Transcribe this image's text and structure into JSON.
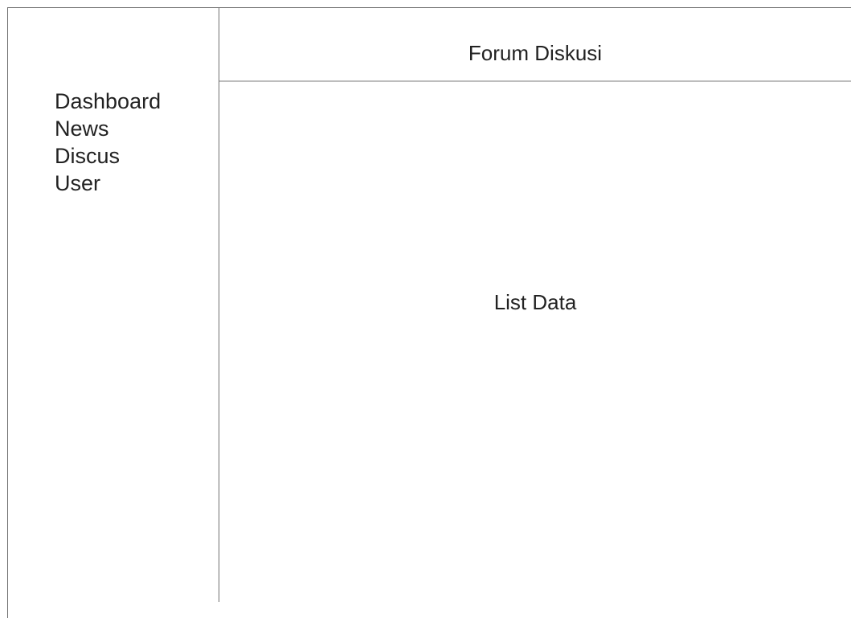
{
  "sidebar": {
    "items": [
      {
        "label": "Dashboard"
      },
      {
        "label": "News"
      },
      {
        "label": "Discus"
      },
      {
        "label": "User"
      }
    ]
  },
  "header": {
    "title": "Forum Diskusi"
  },
  "main": {
    "placeholder_text": "List Data"
  }
}
